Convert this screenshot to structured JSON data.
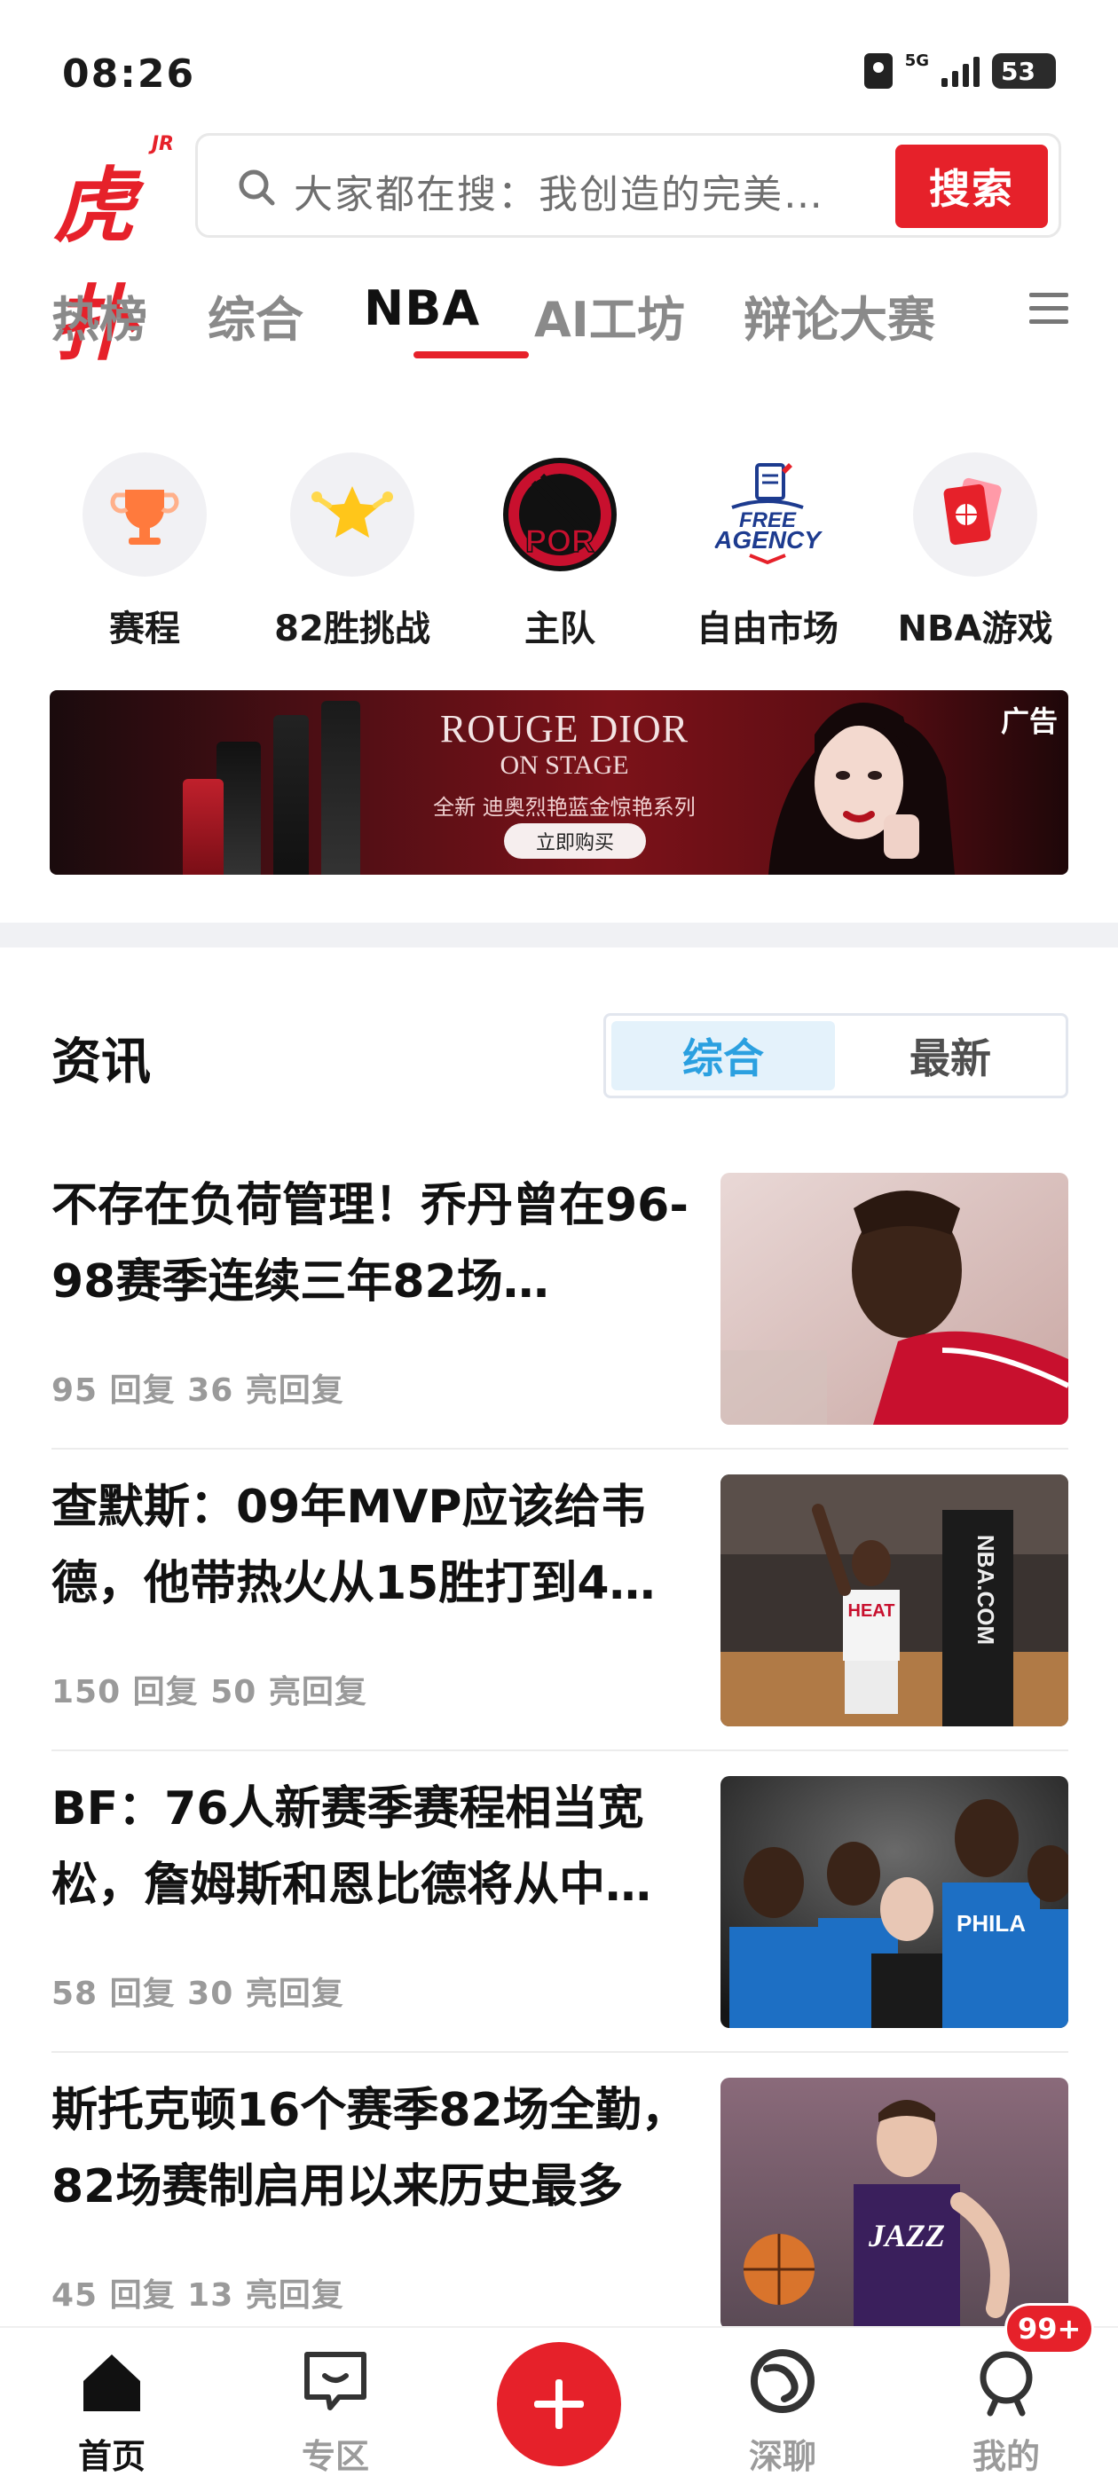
{
  "status_bar": {
    "time": "08:26",
    "network": "5G",
    "battery": "53"
  },
  "header": {
    "logo_text": "虎扑",
    "logo_badge": "JR",
    "search_placeholder": "大家都在搜：我创造的完美…",
    "search_button": "搜索"
  },
  "tabs": {
    "items": [
      "热榜",
      "综合",
      "NBA",
      "AI工坊",
      "辩论大赛"
    ],
    "active": "NBA"
  },
  "quick_entries": [
    {
      "label": "赛程",
      "icon": "trophy-icon"
    },
    {
      "label": "82胜挑战",
      "icon": "star-crown-icon"
    },
    {
      "label": "主队",
      "icon": "team-logo-icon"
    },
    {
      "label": "自由市场",
      "icon": "free-agency-icon"
    },
    {
      "label": "NBA游戏",
      "icon": "game-cards-icon"
    }
  ],
  "team_logo_text": "POR",
  "free_agency_text": {
    "line1": "FREE",
    "line2": "AGENCY"
  },
  "banner": {
    "title": "ROUGE DIOR",
    "subtitle": "ON STAGE",
    "tagline": "全新 迪奥烈艳蓝金惊艳系列",
    "cta": "立即购买",
    "ad_tag": "广告"
  },
  "news": {
    "section_title": "资讯",
    "segments": [
      "综合",
      "最新"
    ],
    "active_segment": "综合",
    "items": [
      {
        "title": "不存在负荷管理！乔丹曾在96-98赛季连续三年82场…",
        "meta": "95 回复 36 亮回复"
      },
      {
        "title": "查默斯：09年MVP应该给韦德，他带热火从15胜打到4…",
        "meta": "150 回复 50 亮回复"
      },
      {
        "title": "BF：76人新赛季赛程相当宽松，詹姆斯和恩比德将从中…",
        "meta": "58 回复 30 亮回复"
      },
      {
        "title": "斯托克顿16个赛季82场全勤，82场赛制启用以来历史最多",
        "meta": "45 回复 13 亮回复"
      }
    ]
  },
  "thumb_text": {
    "heat": "HEAT",
    "nba_com": "NBA.COM",
    "phila": "PHILA",
    "jazz": "JAZZ"
  },
  "bottom_nav": {
    "items": [
      "首页",
      "专区",
      "深聊",
      "我的"
    ],
    "active": "首页",
    "badge": "99+"
  },
  "colors": {
    "brand_red": "#e6212a",
    "segment_blue": "#2ba0e0"
  }
}
